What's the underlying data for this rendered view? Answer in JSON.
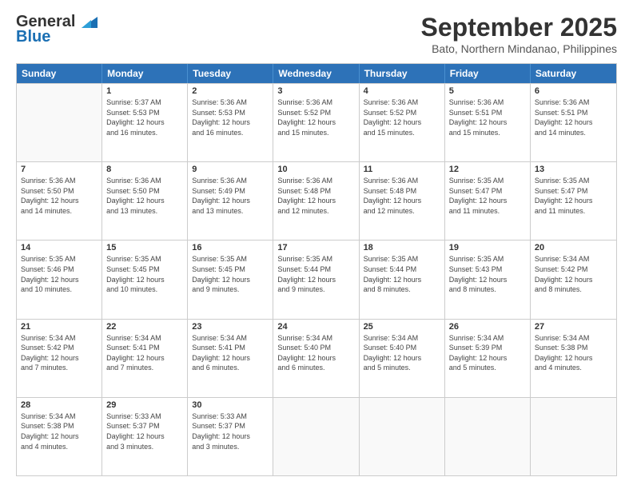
{
  "header": {
    "logo_general": "General",
    "logo_blue": "Blue",
    "month_year": "September 2025",
    "location": "Bato, Northern Mindanao, Philippines"
  },
  "days_of_week": [
    "Sunday",
    "Monday",
    "Tuesday",
    "Wednesday",
    "Thursday",
    "Friday",
    "Saturday"
  ],
  "rows": [
    [
      {
        "day": "",
        "lines": []
      },
      {
        "day": "1",
        "lines": [
          "Sunrise: 5:37 AM",
          "Sunset: 5:53 PM",
          "Daylight: 12 hours",
          "and 16 minutes."
        ]
      },
      {
        "day": "2",
        "lines": [
          "Sunrise: 5:36 AM",
          "Sunset: 5:53 PM",
          "Daylight: 12 hours",
          "and 16 minutes."
        ]
      },
      {
        "day": "3",
        "lines": [
          "Sunrise: 5:36 AM",
          "Sunset: 5:52 PM",
          "Daylight: 12 hours",
          "and 15 minutes."
        ]
      },
      {
        "day": "4",
        "lines": [
          "Sunrise: 5:36 AM",
          "Sunset: 5:52 PM",
          "Daylight: 12 hours",
          "and 15 minutes."
        ]
      },
      {
        "day": "5",
        "lines": [
          "Sunrise: 5:36 AM",
          "Sunset: 5:51 PM",
          "Daylight: 12 hours",
          "and 15 minutes."
        ]
      },
      {
        "day": "6",
        "lines": [
          "Sunrise: 5:36 AM",
          "Sunset: 5:51 PM",
          "Daylight: 12 hours",
          "and 14 minutes."
        ]
      }
    ],
    [
      {
        "day": "7",
        "lines": [
          "Sunrise: 5:36 AM",
          "Sunset: 5:50 PM",
          "Daylight: 12 hours",
          "and 14 minutes."
        ]
      },
      {
        "day": "8",
        "lines": [
          "Sunrise: 5:36 AM",
          "Sunset: 5:50 PM",
          "Daylight: 12 hours",
          "and 13 minutes."
        ]
      },
      {
        "day": "9",
        "lines": [
          "Sunrise: 5:36 AM",
          "Sunset: 5:49 PM",
          "Daylight: 12 hours",
          "and 13 minutes."
        ]
      },
      {
        "day": "10",
        "lines": [
          "Sunrise: 5:36 AM",
          "Sunset: 5:48 PM",
          "Daylight: 12 hours",
          "and 12 minutes."
        ]
      },
      {
        "day": "11",
        "lines": [
          "Sunrise: 5:36 AM",
          "Sunset: 5:48 PM",
          "Daylight: 12 hours",
          "and 12 minutes."
        ]
      },
      {
        "day": "12",
        "lines": [
          "Sunrise: 5:35 AM",
          "Sunset: 5:47 PM",
          "Daylight: 12 hours",
          "and 11 minutes."
        ]
      },
      {
        "day": "13",
        "lines": [
          "Sunrise: 5:35 AM",
          "Sunset: 5:47 PM",
          "Daylight: 12 hours",
          "and 11 minutes."
        ]
      }
    ],
    [
      {
        "day": "14",
        "lines": [
          "Sunrise: 5:35 AM",
          "Sunset: 5:46 PM",
          "Daylight: 12 hours",
          "and 10 minutes."
        ]
      },
      {
        "day": "15",
        "lines": [
          "Sunrise: 5:35 AM",
          "Sunset: 5:45 PM",
          "Daylight: 12 hours",
          "and 10 minutes."
        ]
      },
      {
        "day": "16",
        "lines": [
          "Sunrise: 5:35 AM",
          "Sunset: 5:45 PM",
          "Daylight: 12 hours",
          "and 9 minutes."
        ]
      },
      {
        "day": "17",
        "lines": [
          "Sunrise: 5:35 AM",
          "Sunset: 5:44 PM",
          "Daylight: 12 hours",
          "and 9 minutes."
        ]
      },
      {
        "day": "18",
        "lines": [
          "Sunrise: 5:35 AM",
          "Sunset: 5:44 PM",
          "Daylight: 12 hours",
          "and 8 minutes."
        ]
      },
      {
        "day": "19",
        "lines": [
          "Sunrise: 5:35 AM",
          "Sunset: 5:43 PM",
          "Daylight: 12 hours",
          "and 8 minutes."
        ]
      },
      {
        "day": "20",
        "lines": [
          "Sunrise: 5:34 AM",
          "Sunset: 5:42 PM",
          "Daylight: 12 hours",
          "and 8 minutes."
        ]
      }
    ],
    [
      {
        "day": "21",
        "lines": [
          "Sunrise: 5:34 AM",
          "Sunset: 5:42 PM",
          "Daylight: 12 hours",
          "and 7 minutes."
        ]
      },
      {
        "day": "22",
        "lines": [
          "Sunrise: 5:34 AM",
          "Sunset: 5:41 PM",
          "Daylight: 12 hours",
          "and 7 minutes."
        ]
      },
      {
        "day": "23",
        "lines": [
          "Sunrise: 5:34 AM",
          "Sunset: 5:41 PM",
          "Daylight: 12 hours",
          "and 6 minutes."
        ]
      },
      {
        "day": "24",
        "lines": [
          "Sunrise: 5:34 AM",
          "Sunset: 5:40 PM",
          "Daylight: 12 hours",
          "and 6 minutes."
        ]
      },
      {
        "day": "25",
        "lines": [
          "Sunrise: 5:34 AM",
          "Sunset: 5:40 PM",
          "Daylight: 12 hours",
          "and 5 minutes."
        ]
      },
      {
        "day": "26",
        "lines": [
          "Sunrise: 5:34 AM",
          "Sunset: 5:39 PM",
          "Daylight: 12 hours",
          "and 5 minutes."
        ]
      },
      {
        "day": "27",
        "lines": [
          "Sunrise: 5:34 AM",
          "Sunset: 5:38 PM",
          "Daylight: 12 hours",
          "and 4 minutes."
        ]
      }
    ],
    [
      {
        "day": "28",
        "lines": [
          "Sunrise: 5:34 AM",
          "Sunset: 5:38 PM",
          "Daylight: 12 hours",
          "and 4 minutes."
        ]
      },
      {
        "day": "29",
        "lines": [
          "Sunrise: 5:33 AM",
          "Sunset: 5:37 PM",
          "Daylight: 12 hours",
          "and 3 minutes."
        ]
      },
      {
        "day": "30",
        "lines": [
          "Sunrise: 5:33 AM",
          "Sunset: 5:37 PM",
          "Daylight: 12 hours",
          "and 3 minutes."
        ]
      },
      {
        "day": "",
        "lines": []
      },
      {
        "day": "",
        "lines": []
      },
      {
        "day": "",
        "lines": []
      },
      {
        "day": "",
        "lines": []
      }
    ]
  ]
}
